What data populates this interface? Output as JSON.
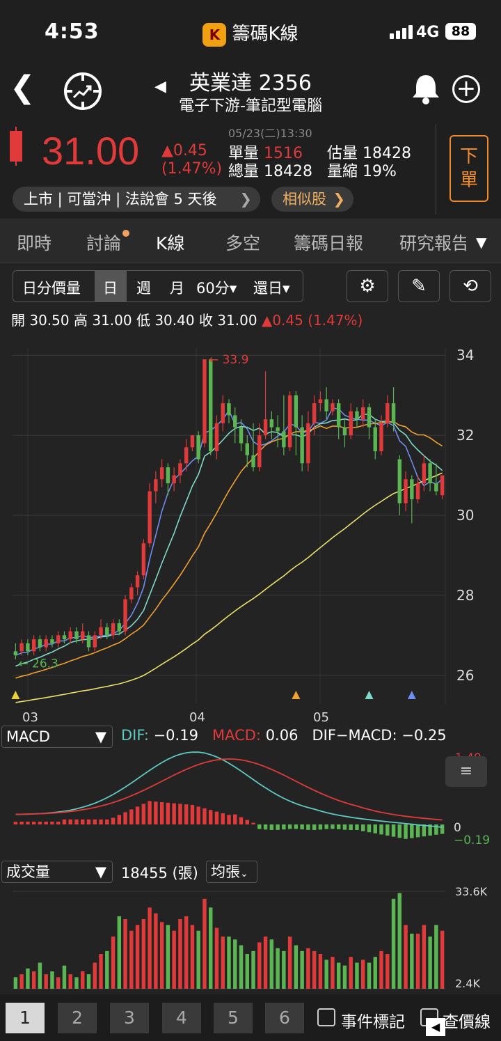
{
  "status": {
    "time": "4:53",
    "app_name": "籌碼K線",
    "app_logo": "K",
    "network": "4G",
    "battery": "88"
  },
  "header": {
    "name": "英業達 2356",
    "category": "電子下游-筆記型電腦"
  },
  "quote": {
    "price": "31.00",
    "change": "▲0.45",
    "change_pct": "(1.47%)",
    "datetime": "05/23(二)13:30",
    "single_vol_label": "單量",
    "single_vol": "1516",
    "est_vol_label": "估量",
    "est_vol": "18428",
    "total_vol_label": "總量",
    "total_vol": "18428",
    "vol_shrink_label": "量縮",
    "vol_shrink": "19%",
    "order_label": "下單",
    "tags": "上市 | 可當沖 | 法說會 5 天後",
    "similar": "相似股"
  },
  "tabs": [
    "即時",
    "討論",
    "K線",
    "多空",
    "籌碼日報",
    "研究報告"
  ],
  "toolbar": {
    "intraday": "日分價量",
    "day": "日",
    "week": "週",
    "month": "月",
    "min60": "60分▾",
    "restore": "還日▾"
  },
  "ohlc": {
    "open": "開 30.50",
    "high": "高 31.00",
    "low": "低 30.40",
    "close": "收 31.00",
    "chg": "▲0.45 (1.47%)"
  },
  "chart_data": [
    {
      "type": "candlestick",
      "title": "",
      "y_ticks": [
        "34",
        "32",
        "30",
        "28",
        "26"
      ],
      "ylim": [
        25.3,
        34.7
      ],
      "x_ticks": [
        "03",
        "04",
        "05"
      ],
      "annotations": [
        "33.9",
        "26.3"
      ],
      "candles": [
        [
          26.6,
          26.5,
          26.4,
          26.8
        ],
        [
          26.6,
          26.8,
          26.5,
          26.9
        ],
        [
          26.8,
          26.6,
          26.5,
          26.9
        ],
        [
          26.6,
          26.9,
          26.5,
          27.0
        ],
        [
          26.9,
          26.7,
          26.6,
          27.0
        ],
        [
          26.7,
          26.9,
          26.6,
          27.0
        ],
        [
          26.9,
          26.8,
          26.7,
          27.0
        ],
        [
          26.8,
          27.0,
          26.7,
          27.1
        ],
        [
          27.0,
          26.9,
          26.8,
          27.1
        ],
        [
          26.9,
          27.1,
          26.8,
          27.2
        ],
        [
          27.1,
          26.9,
          26.8,
          27.2
        ],
        [
          26.9,
          27.1,
          26.8,
          27.3
        ],
        [
          27.0,
          26.7,
          26.6,
          27.1
        ],
        [
          26.7,
          27.0,
          26.6,
          27.1
        ],
        [
          27.0,
          27.2,
          26.9,
          27.4
        ],
        [
          27.2,
          27.0,
          26.9,
          27.3
        ],
        [
          27.0,
          27.3,
          26.9,
          27.4
        ],
        [
          27.3,
          27.1,
          27.0,
          27.4
        ],
        [
          27.1,
          27.9,
          27.0,
          28.0
        ],
        [
          27.9,
          28.2,
          27.8,
          28.3
        ],
        [
          28.2,
          28.5,
          28.0,
          28.6
        ],
        [
          28.5,
          29.3,
          28.4,
          29.4
        ],
        [
          29.3,
          30.6,
          29.2,
          30.8
        ],
        [
          30.6,
          30.9,
          30.3,
          31.1
        ],
        [
          30.9,
          31.2,
          30.7,
          31.4
        ],
        [
          31.2,
          30.8,
          30.5,
          31.3
        ],
        [
          30.8,
          31.0,
          30.6,
          31.2
        ],
        [
          31.0,
          31.3,
          30.8,
          31.4
        ],
        [
          31.3,
          31.7,
          31.1,
          31.9
        ],
        [
          31.7,
          32.0,
          31.6,
          32.0
        ],
        [
          32.0,
          31.4,
          31.3,
          32.1
        ],
        [
          31.8,
          33.9,
          31.7,
          33.9
        ],
        [
          33.9,
          31.6,
          31.5,
          33.9
        ],
        [
          31.6,
          32.3,
          31.4,
          32.5
        ],
        [
          32.3,
          32.8,
          32.1,
          33.0
        ],
        [
          32.8,
          32.5,
          32.3,
          32.9
        ],
        [
          32.5,
          32.2,
          31.8,
          32.7
        ],
        [
          32.2,
          31.8,
          31.6,
          32.4
        ],
        [
          31.8,
          31.5,
          31.2,
          32.0
        ],
        [
          31.5,
          31.2,
          31.1,
          32.3
        ],
        [
          31.2,
          32.0,
          31.1,
          32.3
        ],
        [
          32.0,
          32.4,
          31.9,
          33.6
        ],
        [
          32.4,
          32.2,
          31.9,
          32.6
        ],
        [
          32.2,
          32.1,
          31.7,
          32.5
        ],
        [
          32.1,
          31.7,
          31.5,
          33.0
        ],
        [
          31.7,
          33.0,
          31.6,
          33.1
        ],
        [
          33.0,
          32.2,
          31.5,
          33.1
        ],
        [
          32.2,
          31.3,
          31.1,
          32.5
        ],
        [
          31.3,
          32.3,
          31.1,
          32.6
        ],
        [
          32.3,
          32.8,
          32.0,
          33.0
        ],
        [
          32.8,
          32.9,
          32.6,
          33.1
        ],
        [
          32.9,
          32.6,
          32.4,
          33.2
        ],
        [
          32.6,
          32.8,
          32.5,
          32.9
        ],
        [
          32.8,
          32.2,
          31.9,
          32.9
        ],
        [
          32.2,
          32.0,
          31.7,
          32.4
        ],
        [
          32.0,
          32.6,
          31.9,
          32.8
        ],
        [
          32.6,
          32.4,
          32.2,
          32.7
        ],
        [
          32.4,
          32.7,
          32.2,
          32.9
        ],
        [
          32.7,
          32.2,
          31.9,
          32.8
        ],
        [
          32.2,
          31.6,
          31.4,
          32.4
        ],
        [
          31.6,
          32.3,
          31.5,
          32.5
        ],
        [
          32.3,
          32.8,
          32.2,
          33.0
        ],
        [
          32.8,
          32.3,
          32.1,
          33.2
        ],
        [
          31.4,
          30.3,
          30.0,
          31.5
        ],
        [
          30.3,
          30.9,
          30.1,
          31.1
        ],
        [
          30.9,
          30.4,
          29.8,
          31.0
        ],
        [
          30.4,
          30.8,
          30.3,
          31.0
        ],
        [
          30.8,
          31.3,
          30.6,
          31.5
        ],
        [
          31.3,
          30.8,
          30.6,
          31.4
        ],
        [
          30.8,
          30.6,
          30.5,
          31.3
        ],
        [
          30.5,
          31.0,
          30.4,
          31.0
        ]
      ],
      "ma_colors": [
        "#6f8cf0",
        "#7fd8c8",
        "#f0a030",
        "#e8e06a"
      ]
    },
    {
      "type": "macd",
      "selector": "MACD",
      "dif_label": "DIF:",
      "dif": "−0.19",
      "macd_label": "MACD:",
      "macd": "0.06",
      "osc_label": "DIF−MACD:",
      "osc": "−0.25",
      "y_labels": [
        "1.49",
        "0",
        "−0.19"
      ]
    },
    {
      "type": "bar",
      "selector": "成交量",
      "volume": "18455 (張)",
      "unit_button": "均張",
      "y_labels": [
        "33.6K",
        "2.4K"
      ]
    }
  ],
  "bottom": {
    "pages": [
      "1",
      "2",
      "3",
      "4",
      "5",
      "6"
    ],
    "events": "事件標記",
    "lookup": "查價線"
  }
}
